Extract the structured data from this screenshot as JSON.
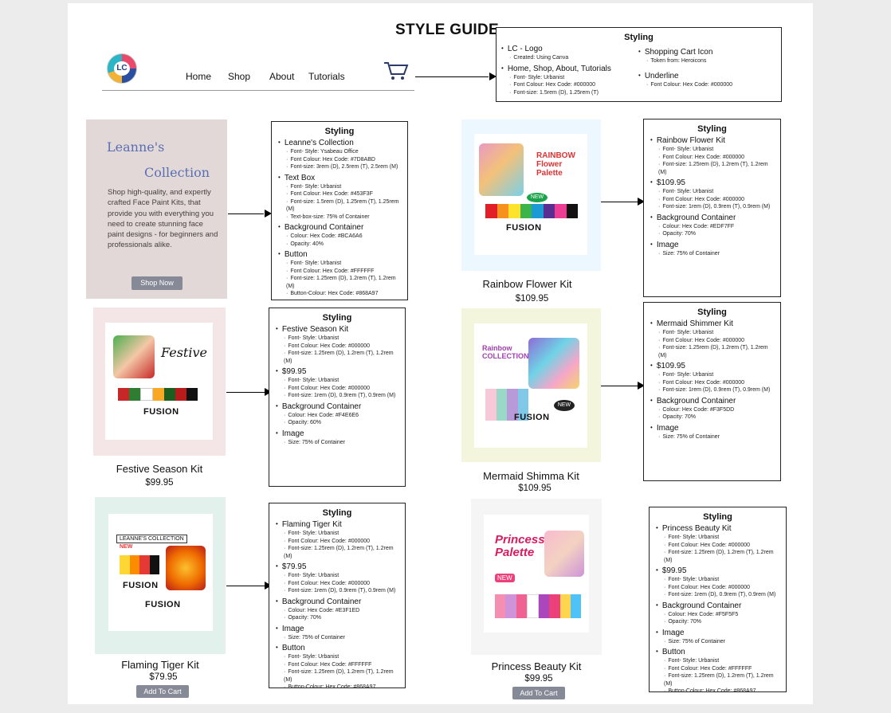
{
  "title": "STYLE GUIDE",
  "nav": {
    "logo_text": "LC",
    "links": [
      "Home",
      "Shop",
      "About",
      "Tutorials"
    ]
  },
  "header_styling": {
    "heading": "Styling",
    "left": [
      {
        "title": "LC - Logo",
        "lines": [
          "Created: Using Canva"
        ]
      },
      {
        "title": "Home, Shop, About, Tutorials",
        "lines": [
          "Font- Style: Urbanist",
          "Font Colour: Hex Code: #000000",
          "Font-size: 1.5rem (D), 1.25rem (T)"
        ]
      }
    ],
    "right": [
      {
        "title": "Shopping Cart Icon",
        "lines": [
          "Token from: Heroicons"
        ]
      },
      {
        "title": "Underline",
        "lines": [
          "Font Colour: Hex Code: #000000"
        ]
      }
    ]
  },
  "hero": {
    "title1": "Leanne's",
    "title2": "Collection",
    "text": "Shop high-quality, and expertly crafted Face Paint Kits, that provide you with everything you need to create stunning face paint designs - for beginners and professionals alike.",
    "button": "Shop Now"
  },
  "hero_styling": {
    "heading": "Styling",
    "sections": [
      {
        "title": "Leanne's Collection",
        "lines": [
          "Font- Style: Ysabeau Office",
          "Font Colour: Hex Code: #7D8ABD",
          "Font-size: 3rem (D), 2.5rem (T), 2.5rem (M)"
        ]
      },
      {
        "title": "Text Box",
        "lines": [
          "Font- Style: Urbanist",
          "Font Colour: Hex Code: #453F3F",
          "Font-size: 1.5rem (D), 1.25rem (T), 1.25rem (M)",
          "Text-box-size: 75% of Container"
        ]
      },
      {
        "title": "Background Container",
        "lines": [
          "Colour: Hex Code: #BCA6A6",
          "Opacity: 40%"
        ]
      },
      {
        "title": "Button",
        "lines": [
          "Font- Style: Urbanist",
          "Font Colour: Hex Code: #FFFFFF",
          "Font-size: 1.25rem (D), 1.2rem (T), 1.2rem (M)",
          "Button-Colour: Hex Code: #868A97"
        ]
      }
    ]
  },
  "products": {
    "rainbow": {
      "name": "Rainbow Flower Kit",
      "price": "$109.95",
      "bg": "#edf7ff",
      "art": {
        "brand": "FUSION",
        "label": "RAINBOW Flower Palette",
        "badge": "NEW"
      },
      "styling": {
        "heading": "Styling",
        "sections": [
          {
            "title": "Rainbow Flower Kit",
            "lines": [
              "Font- Style: Urbanist",
              "Font Colour: Hex Code: #000000",
              "Font-size: 1.25rem (D), 1.2rem (T), 1.2rem (M)"
            ]
          },
          {
            "title": "$109.95",
            "lines": [
              "Font- Style: Urbanist",
              "Font Colour: Hex Code: #000000",
              "Font-size: 1rem (D), 0.9rem (T), 0.9rem (M)"
            ]
          },
          {
            "title": "Background Container",
            "lines": [
              "Colour: Hex Code: #EDF7FF",
              "Opacity: 70%"
            ]
          },
          {
            "title": "Image",
            "lines": [
              "Size: 75% of Container"
            ]
          }
        ]
      }
    },
    "festive": {
      "name": "Festive Season Kit",
      "price": "$99.95",
      "bg": "#f4e6e6",
      "art": {
        "brand": "FUSION",
        "label": "Festive"
      },
      "styling": {
        "heading": "Styling",
        "sections": [
          {
            "title": "Festive Season Kit",
            "lines": [
              "Font- Style: Urbanist",
              "Font Colour: Hex Code: #000000",
              "Font-size: 1.25rem (D), 1.2rem (T), 1.2rem (M)"
            ]
          },
          {
            "title": "$99.95",
            "lines": [
              "Font- Style: Urbanist",
              "Font Colour: Hex Code: #000000",
              "Font-size: 1rem (D), 0.9rem (T), 0.9rem (M)"
            ]
          },
          {
            "title": "Background Container",
            "lines": [
              "Colour: Hex Code: #F4E6E6",
              "Opacity: 60%"
            ]
          },
          {
            "title": "Image",
            "lines": [
              "Size: 75% of Container"
            ]
          }
        ]
      }
    },
    "mermaid": {
      "name": "Mermaid Shimma Kit",
      "price": "$109.95",
      "bg": "#f3f5dd",
      "art": {
        "brand": "FUSION",
        "label": "Rainbow COLLECTION",
        "badge": "NEW"
      },
      "styling": {
        "heading": "Styling",
        "sections": [
          {
            "title": "Mermaid Shimmer Kit",
            "lines": [
              "Font- Style: Urbanist",
              "Font Colour: Hex Code: #000000",
              "Font-size: 1.25rem (D), 1.2rem (T), 1.2rem (M)"
            ]
          },
          {
            "title": "$109.95",
            "lines": [
              "Font- Style: Urbanist",
              "Font Colour: Hex Code: #000000",
              "Font-size: 1rem (D), 0.9rem (T), 0.9rem (M)"
            ]
          },
          {
            "title": "Background Container",
            "lines": [
              "Colour: Hex Code: #F3F5DD",
              "Opacity: 70%"
            ]
          },
          {
            "title": "Image",
            "lines": [
              "Size: 75% of Container"
            ]
          }
        ]
      }
    },
    "tiger": {
      "name": "Flaming Tiger Kit",
      "price": "$79.95",
      "bg": "#e3f1ed",
      "button": "Add To Cart",
      "art": {
        "brand": "FUSION",
        "label": "LEANNE'S COLLECTION",
        "badge": "NEW"
      },
      "styling": {
        "heading": "Styling",
        "sections": [
          {
            "title": "Flaming Tiger Kit",
            "lines": [
              "Font- Style: Urbanist",
              "Font Colour: Hex Code: #000000",
              "Font-size: 1.25rem (D), 1.2rem (T), 1.2rem (M)"
            ]
          },
          {
            "title": "$79.95",
            "lines": [
              "Font- Style: Urbanist",
              "Font Colour: Hex Code: #000000",
              "Font-size: 1rem (D), 0.9rem (T), 0.9rem (M)"
            ]
          },
          {
            "title": "Background Container",
            "lines": [
              "Colour: Hex Code: #E3F1ED",
              "Opacity: 70%"
            ]
          },
          {
            "title": "Image",
            "lines": [
              "Size: 75% of Container"
            ]
          },
          {
            "title": "Button",
            "lines": [
              "Font- Style: Urbanist",
              "Font Colour: Hex Code: #FFFFFF",
              "Font-size: 1.25rem (D), 1.2rem (T), 1.2rem (M)",
              "Button-Colour: Hex Code: #868A97"
            ]
          }
        ]
      }
    },
    "princess": {
      "name": "Princess Beauty Kit",
      "price": "$99.95",
      "bg": "#f5f5f5",
      "button": "Add To Cart",
      "art": {
        "label": "Princess Palette",
        "badge": "NEW"
      },
      "styling": {
        "heading": "Styling",
        "sections": [
          {
            "title": "Princess Beauty Kit",
            "lines": [
              "Font- Style: Urbanist",
              "Font Colour: Hex Code: #000000",
              "Font-size: 1.25rem (D), 1.2rem (T), 1.2rem (M)"
            ]
          },
          {
            "title": "$99.95",
            "lines": [
              "Font- Style: Urbanist",
              "Font Colour: Hex Code: #000000",
              "Font-size: 1rem (D), 0.9rem (T), 0.9rem (M)"
            ]
          },
          {
            "title": "Background Container",
            "lines": [
              "Colour: Hex Code: #F5F5F5",
              "Opacity: 70%"
            ]
          },
          {
            "title": "Image",
            "lines": [
              "Size: 75% of Container"
            ]
          },
          {
            "title": "Button",
            "lines": [
              "Font- Style: Urbanist",
              "Font Colour: Hex Code: #FFFFFF",
              "Font-size: 1.25rem (D), 1.2rem (T), 1.2rem (M)",
              "Button-Colour: Hex Code: #868A97"
            ]
          }
        ]
      }
    }
  },
  "colors": {
    "accent": "#7d8abd",
    "button": "#868a97",
    "text": "#453f3f"
  }
}
